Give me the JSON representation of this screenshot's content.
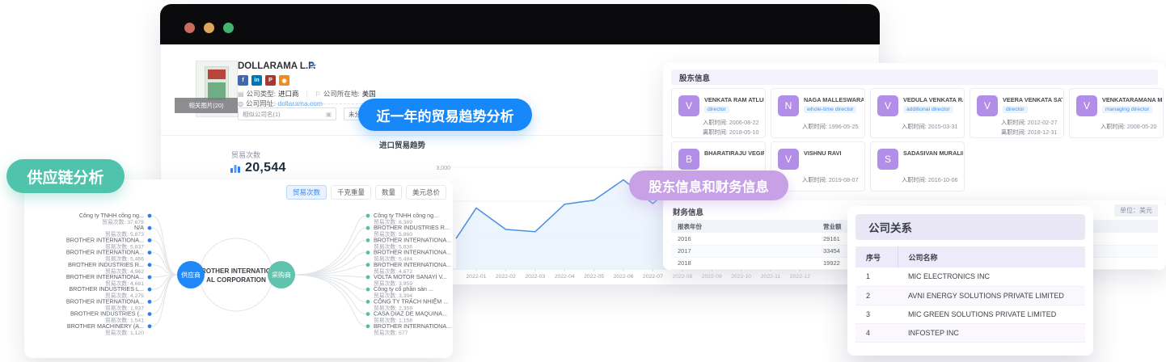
{
  "colors": {
    "pill_supply": "#4fc3ab",
    "pill_trend": "#1688fa",
    "pill_share": "#c7a0e6",
    "dot_red": "#c96c5d",
    "dot_yellow": "#dfa65b",
    "dot_green": "#43b36e",
    "avatar_purple": "#b28ee8",
    "hub_supplier": "#1f87f8",
    "hub_buyer": "#5fc3ae",
    "line_blue": "#4a90e2"
  },
  "pills": {
    "supply_chain": "供应链分析",
    "trade_trend": "近一年的贸易趋势分析",
    "shareholder_finance": "股东信息和财务信息"
  },
  "browser": {
    "company": {
      "name": "DOLLARAMA L.P.",
      "image_caption": "相关图片(20)",
      "social_icons": [
        "facebook",
        "linkedin",
        "pinterest",
        "rss"
      ],
      "social_letters": [
        "f",
        "in",
        "P",
        "●"
      ],
      "type_label": "公司类型:",
      "type_value": "进口商",
      "divider": "|",
      "location_label": "公司所在地:",
      "location_value": "美国",
      "website_label": "公司网址:",
      "website_value": "dollarama.com",
      "similar_input": "相似公司名(1)",
      "group_select": "未分组"
    },
    "stats": {
      "label": "贸易次数",
      "value": "20,544"
    }
  },
  "chart_data": {
    "type": "line",
    "title": "进口贸易趋势",
    "series_name": "贸易次数",
    "x": [
      "2022-01",
      "2022-02",
      "2022-03",
      "2022-04",
      "2022-05",
      "2022-06",
      "2022-07",
      "2022-08",
      "2022-09",
      "2022-10",
      "2022-11",
      "2022-12"
    ],
    "values": [
      1800,
      1170,
      1100,
      1910,
      2030,
      2630,
      1930,
      2700,
      2500,
      2750,
      2950,
      2600
    ],
    "lead_in_value": 900,
    "ylim": [
      0,
      3300
    ],
    "visible_y_tick": "3,000",
    "grid": true,
    "legend": false
  },
  "supply_panel": {
    "tabs": [
      {
        "label": "贸易次数",
        "active": true
      },
      {
        "label": "千克重量",
        "active": false
      },
      {
        "label": "数量",
        "active": false
      },
      {
        "label": "美元总价",
        "active": false
      }
    ],
    "center_line1": "BROTHER INTERNATION",
    "center_line2": "AL CORPORATION",
    "left_hub": "供应商",
    "right_hub": "采购商",
    "metric_label": "贸易次数:",
    "suppliers": [
      {
        "name": "Công ty TNHH công ng...",
        "value": "37,678"
      },
      {
        "name": "N/A",
        "value": "5,873"
      },
      {
        "name": "BROTHER INTERNATIONA...",
        "value": "5,837"
      },
      {
        "name": "BROTHER INTERNATIONA...",
        "value": "5,466"
      },
      {
        "name": "BROTHER INDUSTRIES R...",
        "value": "4,962"
      },
      {
        "name": "BROTHER INTERNATIONA...",
        "value": "4,681"
      },
      {
        "name": "BROTHER INDUSTRIES L...",
        "value": "4,275"
      },
      {
        "name": "BROTHER INTERNATIONA...",
        "value": "1,937"
      },
      {
        "name": "BROTHER INDUSTRIES (...",
        "value": "1,541"
      },
      {
        "name": "BROTHER MACHINERY (A...",
        "value": "1,120"
      }
    ],
    "buyers": [
      {
        "name": "Công ty TNHH công ng...",
        "value": "8,389"
      },
      {
        "name": "BROTHER INDUSTRIES R...",
        "value": "5,860"
      },
      {
        "name": "BROTHER INTERNATIONA...",
        "value": "5,836"
      },
      {
        "name": "BROTHER INTERNATIONA...",
        "value": "5,484"
      },
      {
        "name": "BROTHER INTERNATIONA...",
        "value": "4,672"
      },
      {
        "name": "VOLTA MOTOR SANAYİ V...",
        "value": "3,959"
      },
      {
        "name": "Công ty cổ phần sản ...",
        "value": "3,394"
      },
      {
        "name": "CÔNG TY TRÁCH NHIỆM ...",
        "value": "2,359"
      },
      {
        "name": "CASA DIAZ DE MAQUINA...",
        "value": "1,158"
      },
      {
        "name": "BROTHER INTERNATIONA...",
        "value": "577"
      }
    ]
  },
  "shareholders": {
    "title": "股东信息",
    "joined_label": "入职时间:",
    "left_label": "离职时间:",
    "cards": [
      {
        "initial": "V",
        "name": "VENKATA RAM ATLURI",
        "tag": "director",
        "joined": "2006-08-22",
        "left": "2018-05-10",
        "row": 1
      },
      {
        "initial": "N",
        "name": "NAGA MALLESWARA R...",
        "tag": "whole-time director",
        "joined": "1996-05-25",
        "left": "",
        "row": 1
      },
      {
        "initial": "V",
        "name": "VEDULA VENKATA RAM...",
        "tag": "additional director",
        "joined": "2015-03-31",
        "left": "",
        "row": 1
      },
      {
        "initial": "V",
        "name": "VEERA VENKATA SATYA...",
        "tag": "director",
        "joined": "2012-02-27",
        "left": "2018-12-31",
        "row": 1
      },
      {
        "initial": "V",
        "name": "VENKATARAMANA MAG...",
        "tag": "managing director",
        "joined": "2008-05-20",
        "left": "",
        "row": 1
      },
      {
        "initial": "B",
        "name": "BHARATIRAJU VEGIRAJU",
        "tag": "",
        "joined": "",
        "left": "",
        "row": 2
      },
      {
        "initial": "V",
        "name": "VISHNU RAVI",
        "tag": "",
        "joined": "2019-08-07",
        "left": "",
        "row": 2
      },
      {
        "initial": "S",
        "name": "SADASIVAN MURALIKR...",
        "tag": "",
        "joined": "2016-10-06",
        "left": "",
        "row": 2
      }
    ]
  },
  "finance": {
    "title": "财务信息",
    "unit": "单位：美元",
    "headers": [
      "报表年份",
      "营业额"
    ],
    "rows": [
      [
        "2016",
        "29161"
      ],
      [
        "2017",
        "33454"
      ],
      [
        "2018",
        "19922"
      ]
    ]
  },
  "relations": {
    "title": "公司关系",
    "headers": [
      "序号",
      "公司名称"
    ],
    "rows": [
      [
        "1",
        "MIC ELECTRONICS INC"
      ],
      [
        "2",
        "AVNI ENERGY SOLUTIONS PRIVATE LIMITED"
      ],
      [
        "3",
        "MIC GREEN SOLUTIONS PRIVATE LIMITED"
      ],
      [
        "4",
        "INFOSTEP INC"
      ]
    ]
  }
}
